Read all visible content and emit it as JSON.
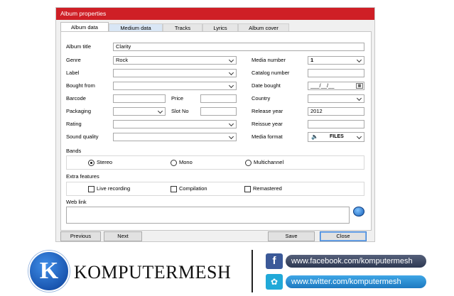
{
  "window": {
    "title": "Album properties"
  },
  "tabs": [
    "Album data",
    "Medium data",
    "Tracks",
    "Lyrics",
    "Album cover"
  ],
  "fields": {
    "album_title": {
      "label": "Album title",
      "value": "Clarity"
    },
    "genre": {
      "label": "Genre",
      "value": "Rock"
    },
    "label": {
      "label": "Label",
      "value": ""
    },
    "bought_from": {
      "label": "Bought from",
      "value": ""
    },
    "barcode": {
      "label": "Barcode",
      "value": ""
    },
    "price": {
      "label": "Price",
      "value": ""
    },
    "packaging": {
      "label": "Packaging",
      "value": ""
    },
    "slot_no": {
      "label": "Slot No",
      "value": ""
    },
    "rating": {
      "label": "Rating",
      "value": ""
    },
    "sound_quality": {
      "label": "Sound quality",
      "value": ""
    },
    "media_number": {
      "label": "Media number",
      "value": "1"
    },
    "catalog_number": {
      "label": "Catalog number",
      "value": ""
    },
    "date_bought": {
      "label": "Date bought",
      "value": "___/__/__"
    },
    "country": {
      "label": "Country",
      "value": ""
    },
    "release_year": {
      "label": "Release year",
      "value": "2012"
    },
    "reissue_year": {
      "label": "Reissue year",
      "value": ""
    },
    "media_format": {
      "label": "Media format",
      "value": "FILES"
    }
  },
  "bands": {
    "label": "Bands",
    "options": [
      "Stereo",
      "Mono",
      "Multichannel"
    ],
    "selected": "Stereo"
  },
  "extra": {
    "label": "Extra features",
    "options": [
      "Live recording",
      "Compilation",
      "Remastered"
    ]
  },
  "web_link": {
    "label": "Web link",
    "value": ""
  },
  "buttons": {
    "previous": "Previous",
    "next": "Next",
    "save": "Save",
    "close": "Close"
  },
  "branding": {
    "logo_letter": "K",
    "name": "KOMPUTERMESH",
    "facebook_url": "www.facebook.com/komputermesh",
    "twitter_url": "www.twitter.com/komputermesh"
  },
  "colors": {
    "titlebar": "#cf1f26",
    "default_button_border": "#3c7fd1",
    "facebook": "#3b5998",
    "twitter": "#21a9d8"
  }
}
